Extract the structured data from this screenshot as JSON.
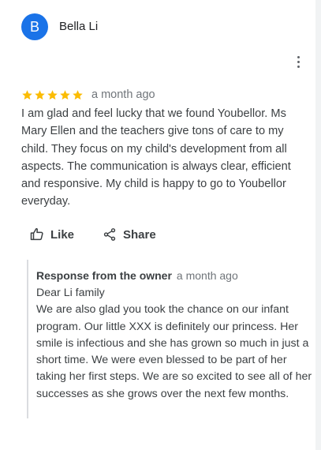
{
  "review": {
    "avatar_letter": "B",
    "author": "Bella Li",
    "rating": 5,
    "date": "a month ago",
    "text": "I am glad and feel lucky that we found Youbellor. Ms Mary Ellen and the teachers give tons of care to my child. They focus on my child's development from all aspects. The communication is always clear, efficient and responsive. My child is happy to go to Youbellor everyday."
  },
  "actions": {
    "like_label": "Like",
    "share_label": "Share"
  },
  "response": {
    "title": "Response from the owner",
    "date": "a month ago",
    "greeting": "Dear Li family",
    "text": "We are also glad you took the chance on our infant program. Our little XXX is definitely our princess. Her smile is infectious and she has grown so much in just a short time. We were even blessed to be part of her taking her first steps. We are so excited to see all of her successes as she grows over the next few months."
  },
  "colors": {
    "avatar": "#1a73e8",
    "star": "#fbbc04",
    "text": "#3c4043",
    "muted": "#70757a"
  }
}
